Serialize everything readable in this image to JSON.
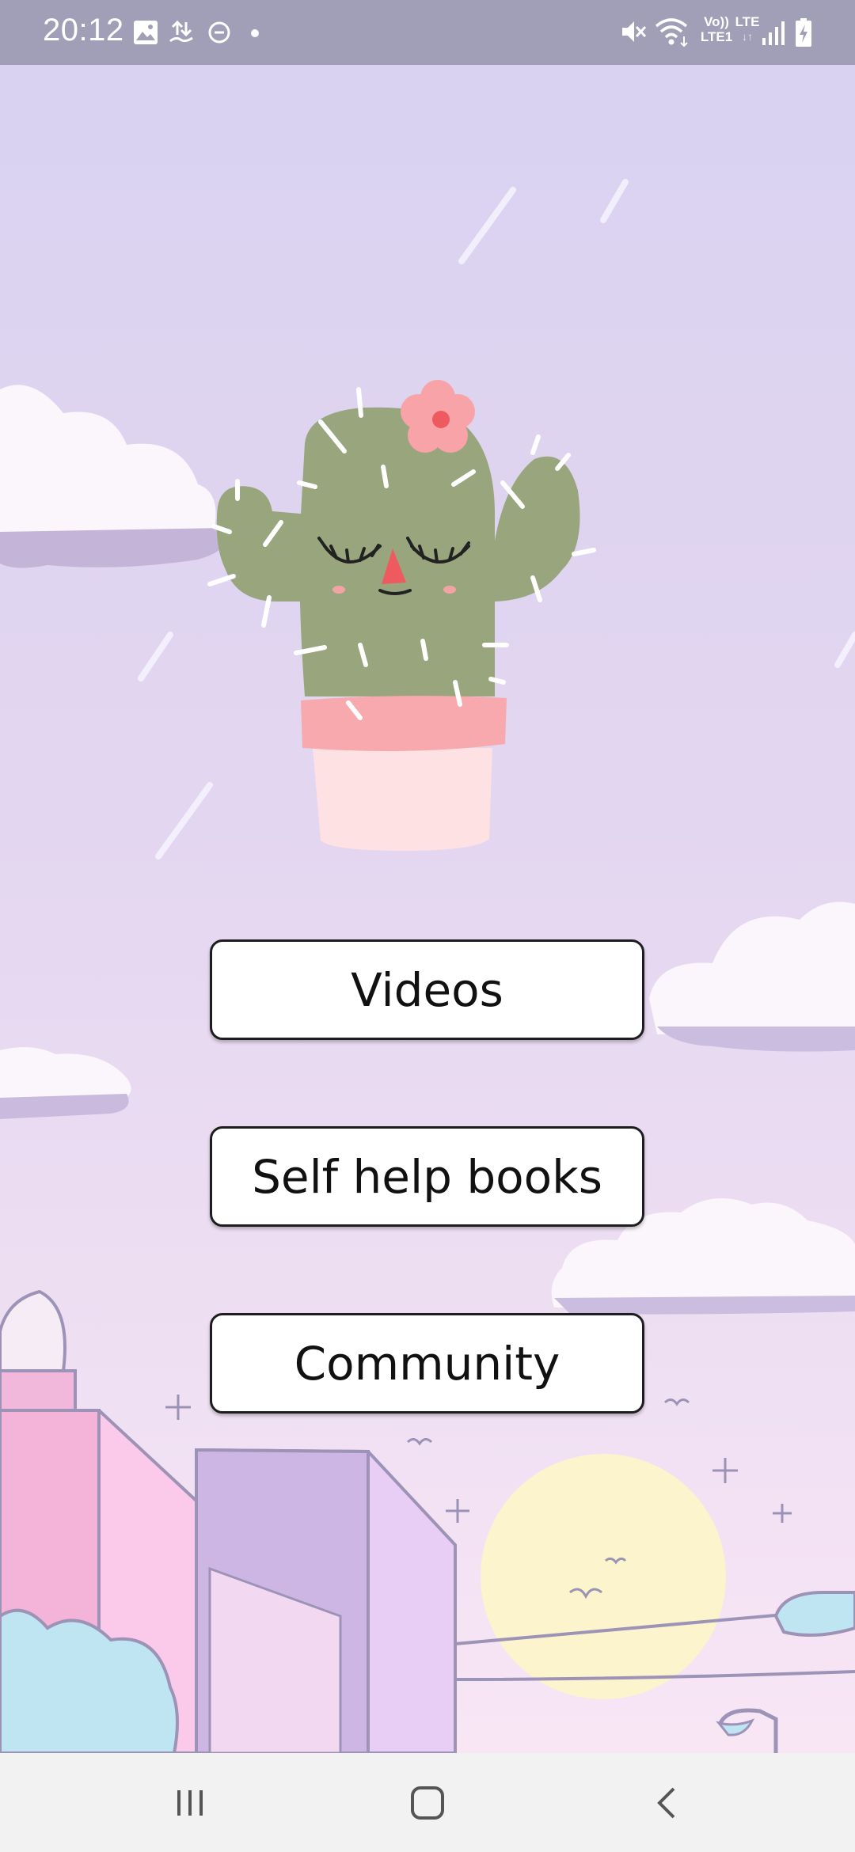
{
  "status_bar": {
    "time": "20:12",
    "network_label_top": "Vo))",
    "network_label_bottom": "LTE1",
    "lte_label": "LTE",
    "left_icons": [
      "image-icon",
      "data-transfer-icon",
      "do-not-disturb-icon",
      "dot-icon"
    ],
    "right_icons": [
      "mute-icon",
      "wifi-icon",
      "signal-icon",
      "battery-charging-icon"
    ]
  },
  "illustration": {
    "name": "cactus-mascot"
  },
  "menu": {
    "videos_label": "Videos",
    "books_label": "Self help books",
    "community_label": "Community"
  },
  "nav_bar": {
    "icons": [
      "recent-apps-icon",
      "home-icon",
      "back-icon"
    ]
  },
  "colors": {
    "sky_top": "#d9d2f0",
    "sky_bottom": "#f7e3f3",
    "cactus_green": "#98a57d",
    "pot_pink": "#f7a9ad",
    "status_bar": "#a19fb8"
  }
}
